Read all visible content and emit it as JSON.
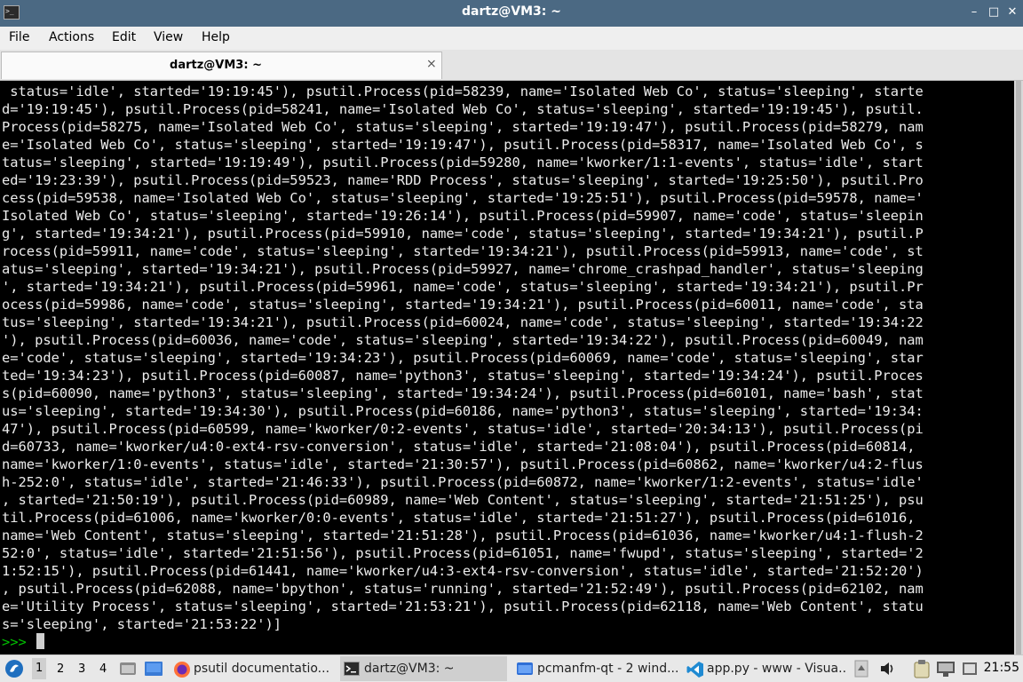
{
  "window": {
    "title": "dartz@VM3: ~",
    "min_glyph": "–",
    "max_glyph": "□",
    "close_glyph": "✕"
  },
  "menu": {
    "file": "File",
    "actions": "Actions",
    "edit": "Edit",
    "view": "View",
    "help": "Help"
  },
  "tab": {
    "label": "dartz@VM3: ~",
    "close_glyph": "⨯"
  },
  "terminal": {
    "lines": [
      " status='idle', started='19:19:45'), psutil.Process(pid=58239, name='Isolated Web Co', status='sleeping', starte",
      "d='19:19:45'), psutil.Process(pid=58241, name='Isolated Web Co', status='sleeping', started='19:19:45'), psutil.",
      "Process(pid=58275, name='Isolated Web Co', status='sleeping', started='19:19:47'), psutil.Process(pid=58279, nam",
      "e='Isolated Web Co', status='sleeping', started='19:19:47'), psutil.Process(pid=58317, name='Isolated Web Co', s",
      "tatus='sleeping', started='19:19:49'), psutil.Process(pid=59280, name='kworker/1:1-events', status='idle', start",
      "ed='19:23:39'), psutil.Process(pid=59523, name='RDD Process', status='sleeping', started='19:25:50'), psutil.Pro",
      "cess(pid=59538, name='Isolated Web Co', status='sleeping', started='19:25:51'), psutil.Process(pid=59578, name='",
      "Isolated Web Co', status='sleeping', started='19:26:14'), psutil.Process(pid=59907, name='code', status='sleepin",
      "g', started='19:34:21'), psutil.Process(pid=59910, name='code', status='sleeping', started='19:34:21'), psutil.P",
      "rocess(pid=59911, name='code', status='sleeping', started='19:34:21'), psutil.Process(pid=59913, name='code', st",
      "atus='sleeping', started='19:34:21'), psutil.Process(pid=59927, name='chrome_crashpad_handler', status='sleeping",
      "', started='19:34:21'), psutil.Process(pid=59961, name='code', status='sleeping', started='19:34:21'), psutil.Pr",
      "ocess(pid=59986, name='code', status='sleeping', started='19:34:21'), psutil.Process(pid=60011, name='code', sta",
      "tus='sleeping', started='19:34:21'), psutil.Process(pid=60024, name='code', status='sleeping', started='19:34:22",
      "'), psutil.Process(pid=60036, name='code', status='sleeping', started='19:34:22'), psutil.Process(pid=60049, nam",
      "e='code', status='sleeping', started='19:34:23'), psutil.Process(pid=60069, name='code', status='sleeping', star",
      "ted='19:34:23'), psutil.Process(pid=60087, name='python3', status='sleeping', started='19:34:24'), psutil.Proces",
      "s(pid=60090, name='python3', status='sleeping', started='19:34:24'), psutil.Process(pid=60101, name='bash', stat",
      "us='sleeping', started='19:34:30'), psutil.Process(pid=60186, name='python3', status='sleeping', started='19:34:",
      "47'), psutil.Process(pid=60599, name='kworker/0:2-events', status='idle', started='20:34:13'), psutil.Process(pi",
      "d=60733, name='kworker/u4:0-ext4-rsv-conversion', status='idle', started='21:08:04'), psutil.Process(pid=60814,",
      "name='kworker/1:0-events', status='idle', started='21:30:57'), psutil.Process(pid=60862, name='kworker/u4:2-flus",
      "h-252:0', status='idle', started='21:46:33'), psutil.Process(pid=60872, name='kworker/1:2-events', status='idle'",
      ", started='21:50:19'), psutil.Process(pid=60989, name='Web Content', status='sleeping', started='21:51:25'), psu",
      "til.Process(pid=61006, name='kworker/0:0-events', status='idle', started='21:51:27'), psutil.Process(pid=61016,",
      "name='Web Content', status='sleeping', started='21:51:28'), psutil.Process(pid=61036, name='kworker/u4:1-flush-2",
      "52:0', status='idle', started='21:51:56'), psutil.Process(pid=61051, name='fwupd', status='sleeping', started='2",
      "1:52:15'), psutil.Process(pid=61441, name='kworker/u4:3-ext4-rsv-conversion', status='idle', started='21:52:20')",
      ", psutil.Process(pid=62088, name='bpython', status='running', started='21:52:49'), psutil.Process(pid=62102, nam",
      "e='Utility Process', status='sleeping', started='21:53:21'), psutil.Process(pid=62118, name='Web Content', statu",
      "s='sleeping', started='21:53:22')]"
    ],
    "prompt": ">>> "
  },
  "taskbar": {
    "desktops": [
      "1",
      "2",
      "3",
      "4"
    ],
    "tasks": {
      "firefox": "psutil documentatio...",
      "terminal": "dartz@VM3: ~",
      "pcmanfm": "pcmanfm-qt - 2 wind...",
      "vscode": "app.py - www - Visua..."
    },
    "clock": "21:55"
  },
  "colors": {
    "titlebar": "#4b6983",
    "terminal_bg": "#000000",
    "terminal_fg": "#ececec",
    "prompt": "#00c000",
    "taskbar_bg": "#e8e8e8"
  }
}
